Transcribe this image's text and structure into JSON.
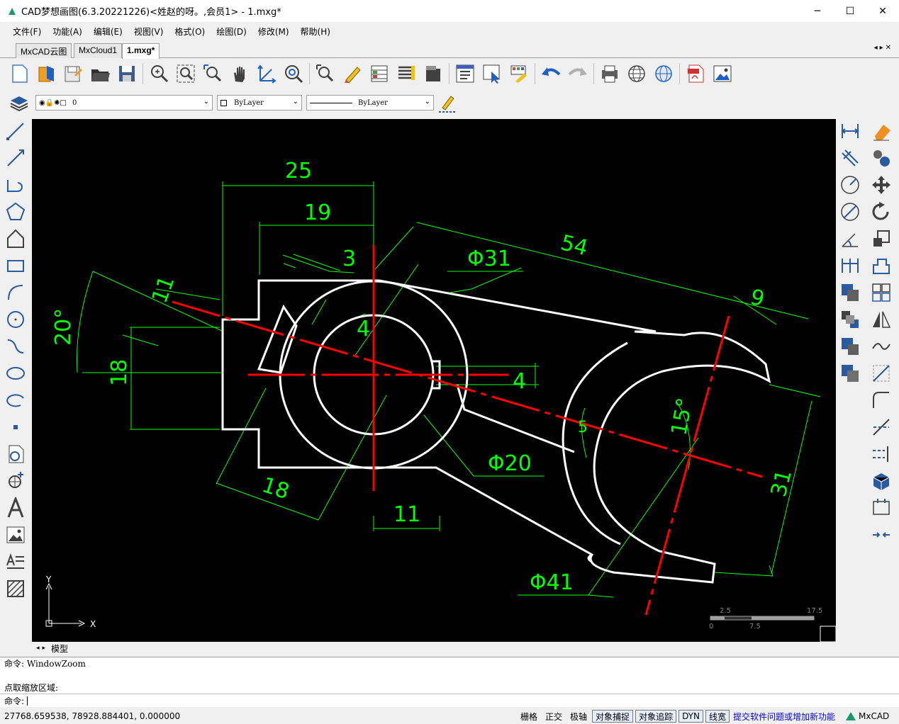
{
  "window": {
    "title": "CAD梦想画图(6.3.20221226)<姓赵的呀。,会员1> - 1.mxg*",
    "minimize": "─",
    "maximize": "☐",
    "close": "✕"
  },
  "menu": [
    "文件(F)",
    "功能(A)",
    "编辑(E)",
    "视图(V)",
    "格式(O)",
    "绘图(D)",
    "修改(M)",
    "帮助(H)"
  ],
  "tabs": [
    "MxCAD云图",
    "MxCloud1",
    "1.mxg*"
  ],
  "layer_bar": {
    "layer_value": "0",
    "color_value": "ByLayer",
    "linetype_value": "ByLayer"
  },
  "model_tab": "模型",
  "command": {
    "line1": "命令: WindowZoom",
    "line2": "点取缩放区域:",
    "prompt": "命令:"
  },
  "status": {
    "coords": "27768.659538,  78928.884401,  0.000000",
    "buttons": [
      "栅格",
      "正交",
      "极轴",
      "对象捕捉",
      "对象追踪",
      "DYN",
      "线宽"
    ],
    "buttons_on": [
      "对象捕捉",
      "对象追踪",
      "DYN",
      "线宽"
    ],
    "feedback_link": "提交软件问题或增加新功能",
    "brand": "MxCAD"
  },
  "drawing": {
    "dims": [
      "25",
      "19",
      "3",
      "Φ31",
      "54",
      "9",
      "11",
      "4",
      "20°",
      "18",
      "4",
      "15°",
      "Φ20",
      "18",
      "11",
      "31",
      "Φ41"
    ],
    "scale_labels": [
      "2.5",
      "17.5",
      "0",
      "7.5"
    ],
    "ucs_x": "X",
    "ucs_y": "Y"
  },
  "colors": {
    "dim_green": "#00ff00",
    "center_red": "#ff0000",
    "outline_white": "#ffffff",
    "canvas_bg": "#000000",
    "link_blue": "#0000ff"
  }
}
